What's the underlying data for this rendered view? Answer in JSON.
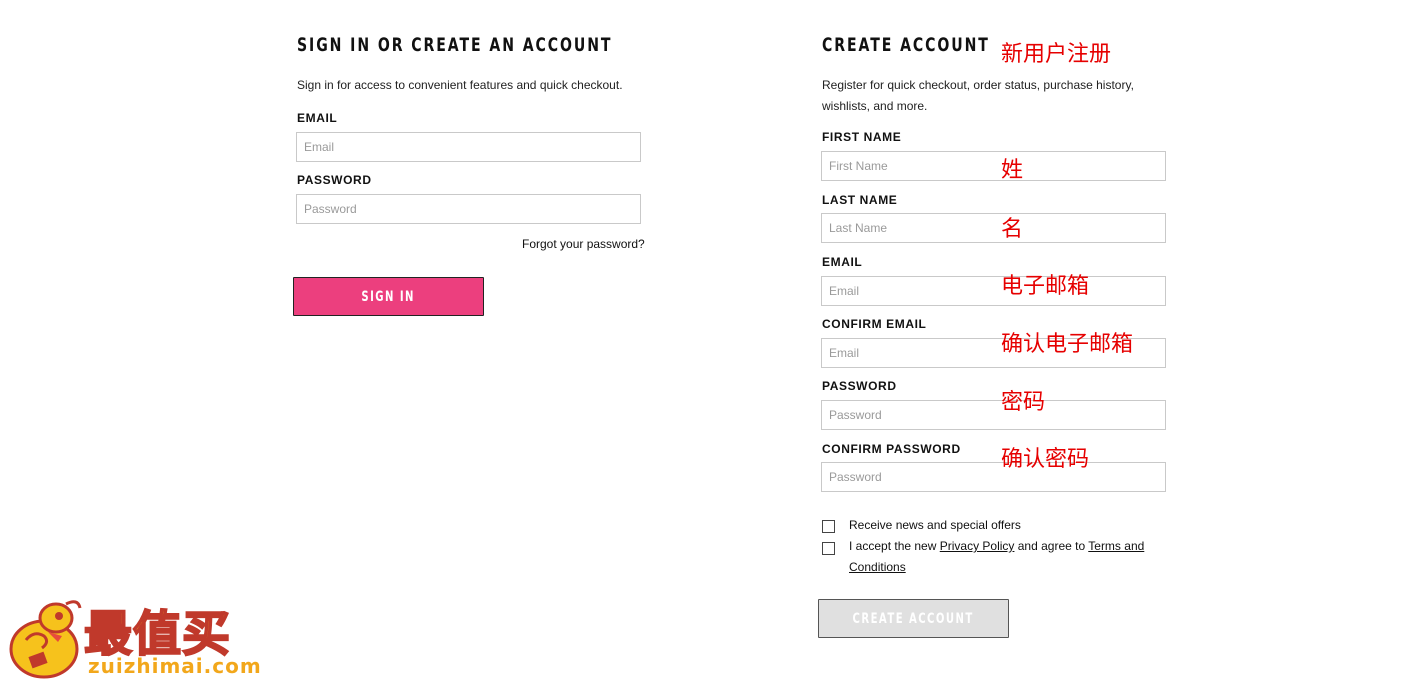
{
  "signin": {
    "title": "SIGN IN OR CREATE AN ACCOUNT",
    "description": "Sign in for access to convenient features and quick checkout.",
    "email_label": "EMAIL",
    "email_placeholder": "Email",
    "password_label": "PASSWORD",
    "password_placeholder": "Password",
    "forgot_link": "Forgot your password?",
    "button_label": "SIGN IN"
  },
  "create": {
    "title": "CREATE ACCOUNT",
    "description_line1": "Register for quick checkout, order status, purchase history,",
    "description_line2": "wishlists, and more.",
    "fields": [
      {
        "label": "FIRST NAME",
        "placeholder": "First Name",
        "annotation": "姓"
      },
      {
        "label": "LAST NAME",
        "placeholder": "Last Name",
        "annotation": "名"
      },
      {
        "label": "EMAIL",
        "placeholder": "Email",
        "annotation": "电子邮箱"
      },
      {
        "label": "CONFIRM EMAIL",
        "placeholder": "Email",
        "annotation": "确认电子邮箱"
      },
      {
        "label": "PASSWORD",
        "placeholder": "Password",
        "annotation": "密码"
      },
      {
        "label": "CONFIRM PASSWORD",
        "placeholder": "Password",
        "annotation": "确认密码"
      }
    ],
    "title_annotation": "新用户注册",
    "news_checkbox": "Receive news and special offers",
    "terms_prefix": "I accept the new ",
    "privacy_link": "Privacy Policy",
    "terms_middle": " and agree to ",
    "terms_link_line1": "Terms and",
    "terms_link_line2": "Conditions",
    "button_label": "CREATE ACCOUNT"
  },
  "watermark": {
    "brand": "最值买",
    "url": "zuizhimai.com"
  },
  "colors": {
    "signin_button": "#ec3f7e",
    "create_button": "#e0e0e0",
    "annotation": "#e60000"
  }
}
